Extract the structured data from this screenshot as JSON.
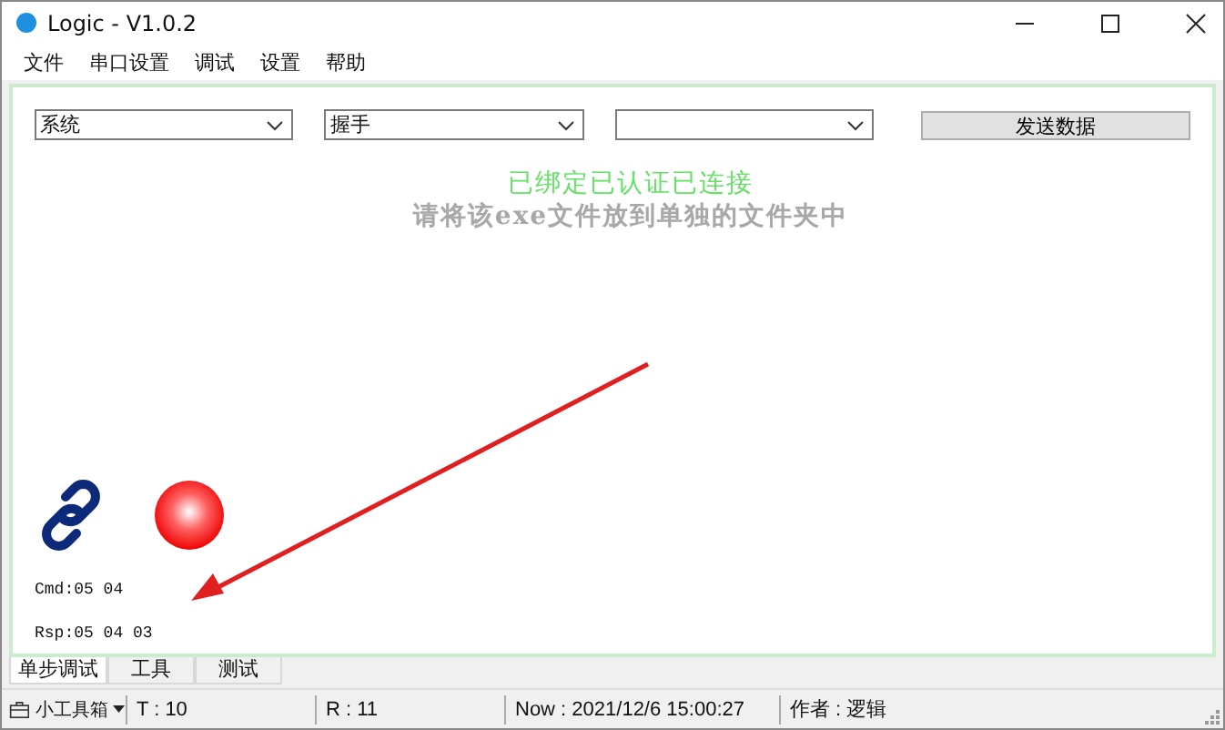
{
  "window": {
    "title": "Logic - V1.0.2"
  },
  "menu": [
    "文件",
    "串口设置",
    "调试",
    "设置",
    "帮助"
  ],
  "selectors": [
    {
      "value": "系统"
    },
    {
      "value": "握手"
    }
  ],
  "send_button": "发送数据",
  "status_text": "已绑定已认证已连接",
  "hint_text": "请将该exe文件放到单独的文件夹中",
  "cmd": "Cmd:05 04",
  "rsp": "Rsp:05 04 03",
  "tabs": [
    {
      "label": "单步调试",
      "selected": true
    },
    {
      "label": "工具",
      "selected": false
    },
    {
      "label": "测试",
      "selected": false
    }
  ],
  "status_bar": {
    "toolbox": "小工具箱",
    "fields": [
      "T : 10",
      "R : 11",
      "Now : 2021/12/6 15:00:27",
      "作者 : 逻辑"
    ]
  }
}
